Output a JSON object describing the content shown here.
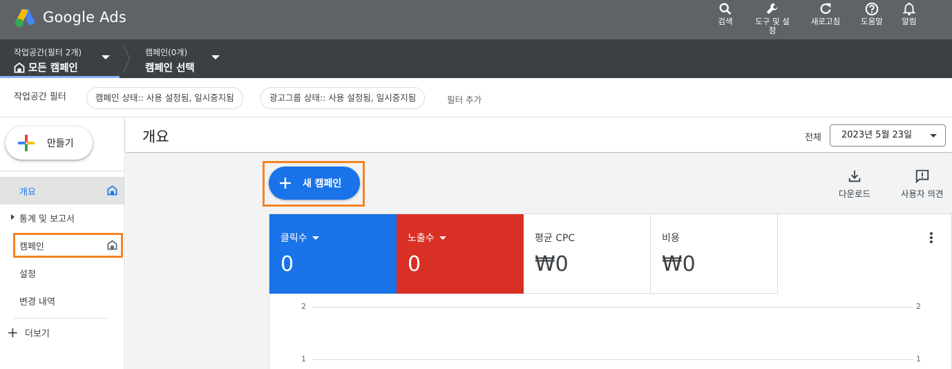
{
  "app": {
    "name": "Google Ads",
    "colors": {
      "topbar": "#5f6368",
      "wsbar": "#3c4043",
      "primary": "#1a73e8",
      "red": "#d93025",
      "highlight": "#f58220"
    }
  },
  "top_actions": [
    {
      "label": "검색",
      "icon": "search-icon"
    },
    {
      "label": "도구 및 설정",
      "icon": "wrench-icon"
    },
    {
      "label": "새로고침",
      "icon": "refresh-icon"
    },
    {
      "label": "도움말",
      "icon": "help-icon"
    },
    {
      "label": "알림",
      "icon": "bell-icon"
    }
  ],
  "workspace": {
    "sub": "작업공간(필터 2개)",
    "main": "모든 캠페인",
    "campaign_sub": "캠페인(0개)",
    "campaign_main": "캠페인 선택"
  },
  "filters": {
    "label": "작업공간 필터",
    "chips": [
      "캠페인 상태:: 사용 설정됨, 일시중지됨",
      "광고그룹 상태:: 사용 설정됨, 일시중지됨"
    ],
    "add": "필터 추가"
  },
  "nav": {
    "create": "만들기",
    "items": [
      {
        "label": "개요",
        "active": true
      },
      {
        "label": "통계 및 보고서"
      },
      {
        "label": "캠페인"
      },
      {
        "label": "설정"
      },
      {
        "label": "변경 내역"
      }
    ],
    "more": "더보기"
  },
  "main": {
    "title": "개요",
    "date_scope": "전체",
    "date": "2023년 5월 23일",
    "new_campaign": "새 캠페인",
    "download": "다운로드",
    "feedback": "사용자 의견"
  },
  "metrics": [
    {
      "name": "클릭수",
      "value": "0",
      "color": "#1a73e8"
    },
    {
      "name": "노출수",
      "value": "0",
      "color": "#d93025"
    },
    {
      "name": "평균 CPC",
      "value": "₩0"
    },
    {
      "name": "비용",
      "value": "₩0"
    }
  ],
  "chart_data": {
    "type": "line",
    "y_ticks": [
      "2",
      "1"
    ],
    "series": []
  }
}
